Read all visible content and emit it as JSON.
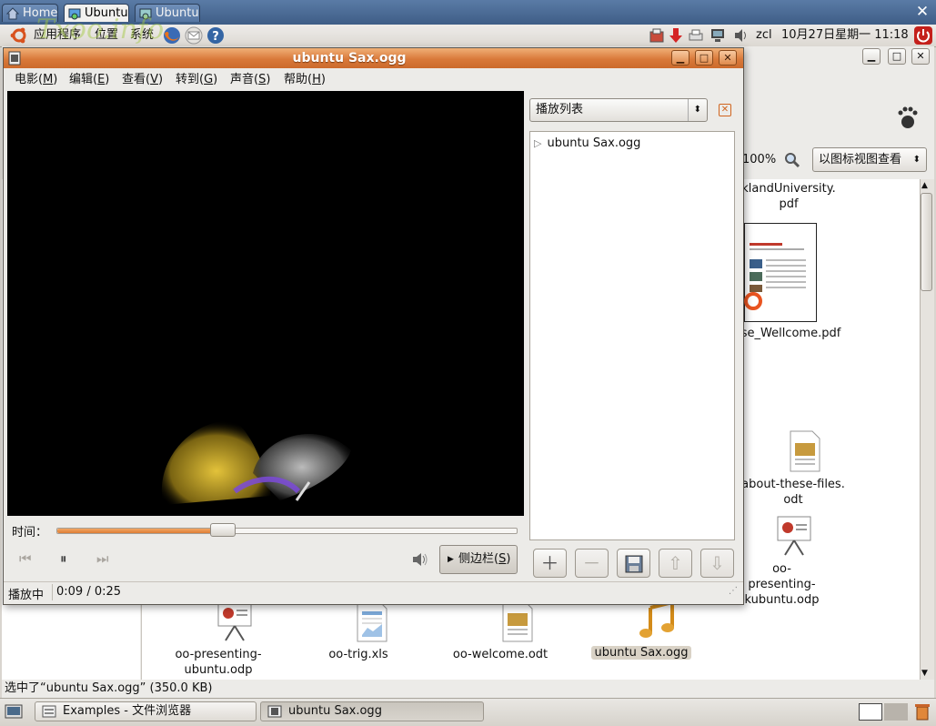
{
  "vnc_tabs": [
    {
      "label": "Home",
      "icon": "home-icon"
    },
    {
      "label": "Ubuntu",
      "icon": "vnc-icon"
    },
    {
      "label": "Ubuntu",
      "icon": "vnc-icon"
    }
  ],
  "panel": {
    "menus": [
      "应用程序",
      "位置",
      "系统"
    ],
    "user": "zcl",
    "clock": "10月27日星期一  11:18",
    "watermark": "Txoo.info"
  },
  "file_browser": {
    "zoom": "100%",
    "view_mode": "以图标视图查看",
    "items": [
      {
        "label": "klandUniversity.\npdf",
        "icon": "pdf-icon"
      },
      {
        "label": "se_Wellcome.pdf",
        "icon": "pdf-thumbnail-icon"
      },
      {
        "label": "about-these-files.\nodt",
        "icon": "document-icon"
      },
      {
        "label": "oo-presenting-\nkubuntu.odp",
        "icon": "presentation-icon"
      },
      {
        "label": "oo-presenting-\nubuntu.odp",
        "icon": "presentation-icon"
      },
      {
        "label": "oo-trig.xls",
        "icon": "spreadsheet-icon"
      },
      {
        "label": "oo-welcome.odt",
        "icon": "document-icon"
      },
      {
        "label": "ubuntu Sax.ogg",
        "icon": "music-icon"
      }
    ],
    "status": "选中了“ubuntu Sax.ogg” (350.0 KB)"
  },
  "totem": {
    "title": "ubuntu Sax.ogg",
    "menus": [
      {
        "label": "电影(",
        "key": "M",
        "end": ")"
      },
      {
        "label": "编辑(",
        "key": "E",
        "end": ")"
      },
      {
        "label": "查看(",
        "key": "V",
        "end": ")"
      },
      {
        "label": "转到(",
        "key": "G",
        "end": ")"
      },
      {
        "label": "声音(",
        "key": "S",
        "end": ")"
      },
      {
        "label": "帮助(",
        "key": "H",
        "end": ")"
      }
    ],
    "playlist_select": "播放列表",
    "playlist": [
      "ubuntu Sax.ogg"
    ],
    "seek_label": "时间：",
    "progress": 0.36,
    "sidebar_button": {
      "label": "侧边栏(",
      "key": "S",
      "end": ")"
    },
    "status": "播放中",
    "time": "0:09 / 0:25"
  },
  "taskbar": [
    {
      "label": "Examples - 文件浏览器",
      "icon": "file-browser-icon"
    },
    {
      "label": "ubuntu Sax.ogg",
      "icon": "video-player-icon"
    }
  ],
  "colors": {
    "accent": "#d9793a",
    "panel": "#dcd8d2",
    "selection": "#d9d2c6"
  }
}
